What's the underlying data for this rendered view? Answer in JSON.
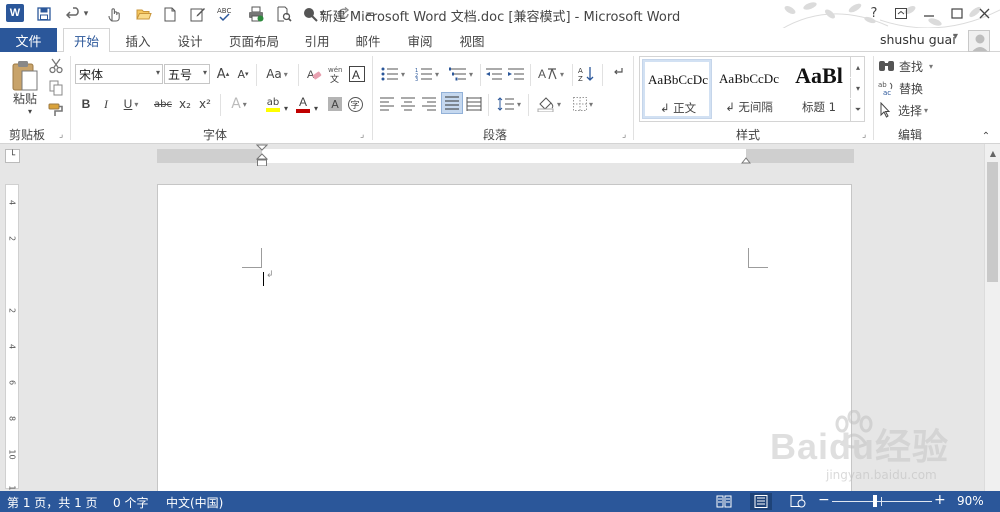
{
  "app": {
    "title": "新建 Microsoft Word 文档.doc [兼容模式] - Microsoft Word",
    "logo_letter": "W"
  },
  "quick_access": [
    {
      "name": "save-icon",
      "glyph": "🖫"
    },
    {
      "name": "undo-icon",
      "glyph": "↶"
    },
    {
      "name": "undo-dropdown-icon",
      "glyph": "⌄"
    },
    {
      "name": "touch-mode-icon",
      "glyph": "☝"
    },
    {
      "name": "open-icon",
      "glyph": "📂"
    },
    {
      "name": "new-doc-icon",
      "glyph": "🗋"
    },
    {
      "name": "edit-icon",
      "glyph": "✎"
    },
    {
      "name": "spelling-icon",
      "glyph": "ᴬᵇᶜ"
    },
    {
      "name": "print-icon",
      "glyph": "⎙"
    },
    {
      "name": "print-preview-icon",
      "glyph": "🔍"
    },
    {
      "name": "draw-icon",
      "glyph": "✒"
    },
    {
      "name": "redo-icon",
      "glyph": "↻"
    },
    {
      "name": "customize-qa-icon",
      "glyph": "="
    }
  ],
  "window_controls": {
    "help": "?",
    "restore_ribbon": "⧉",
    "minimize": "—",
    "maximize": "☐",
    "close": "✕"
  },
  "tabs": {
    "file": "文件",
    "items": [
      "开始",
      "插入",
      "设计",
      "页面布局",
      "引用",
      "邮件",
      "审阅",
      "视图"
    ],
    "active": "开始"
  },
  "user": {
    "name": "shushu guai",
    "caret": "▾"
  },
  "ribbon": {
    "clipboard": {
      "label": "剪贴板",
      "paste": "粘贴"
    },
    "font": {
      "label": "字体",
      "font_name": "宋体",
      "font_size": "五号",
      "grow": "A",
      "shrink": "A",
      "change_case": "Aa",
      "phonetic": "wén",
      "bold": "B",
      "italic": "I",
      "underline": "U",
      "strikethrough": "abc",
      "subscript": "x₂",
      "superscript": "x²",
      "text_effects": "A",
      "highlight": "ab",
      "font_color": "A",
      "char_shading": "A",
      "enclose": "字"
    },
    "paragraph": {
      "label": "段落"
    },
    "styles": {
      "label": "样式",
      "items": [
        {
          "sample": "AaBbCcDc",
          "name": "↲ 正文"
        },
        {
          "sample": "AaBbCcDc",
          "name": "↲ 无间隔"
        },
        {
          "sample": "AaBl",
          "name": "标题 1"
        }
      ]
    },
    "editing": {
      "label": "编辑",
      "find": "查找",
      "replace": "替换",
      "select": "选择"
    }
  },
  "ruler": {
    "ticks": [
      "8",
      "6",
      "4",
      "2",
      "",
      "2",
      "4",
      "6",
      "8",
      "10",
      "12",
      "14",
      "16",
      "18",
      "20",
      "22",
      "24",
      "26",
      "28",
      "30",
      "32",
      "34",
      "36",
      "38",
      "40",
      "42",
      "44",
      "46",
      "48"
    ]
  },
  "vruler": {
    "ticks": [
      "4",
      "2",
      "",
      "2",
      "4",
      "6",
      "8",
      "10",
      "12"
    ]
  },
  "status": {
    "page": "第 1 页，共 1 页",
    "words": "0 个字",
    "language": "中文(中国)",
    "zoom": "90%",
    "zoom_value": 0.9,
    "zoom_minus": "−",
    "zoom_plus": "+"
  },
  "watermark": {
    "brand": "Baidu经验",
    "url": "jingyan.baidu.com"
  },
  "colors": {
    "accent": "#2b579a",
    "font_color_bar": "#c00000",
    "highlight_bar": "#ffff00"
  }
}
